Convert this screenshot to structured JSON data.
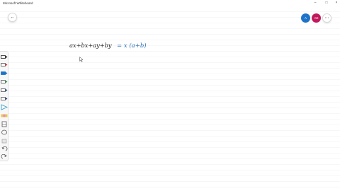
{
  "window": {
    "title": "Microsoft Whiteboard"
  },
  "header": {
    "back_icon": "arrow-left-icon",
    "avatars": [
      {
        "initials": "A",
        "color": "#1e73c8"
      },
      {
        "initials": "AE",
        "color": "#c2185b"
      }
    ],
    "more_icon": "more-icon"
  },
  "toolbar": {
    "tools": [
      {
        "name": "pen-black",
        "color": "#222222"
      },
      {
        "name": "pen-red",
        "color": "#d23a3a"
      },
      {
        "name": "pen-blue",
        "color": "#1e73c8"
      },
      {
        "name": "pen-green",
        "color": "#2e9e4f"
      },
      {
        "name": "pen-darkblue",
        "color": "#2a4f8c"
      },
      {
        "name": "pen-navy",
        "color": "#33407a"
      },
      {
        "name": "pen-cyan",
        "color": "#3aa0c8"
      },
      {
        "name": "highlighter",
        "color": "#e8c84a"
      },
      {
        "name": "eraser",
        "color": "#555555"
      },
      {
        "name": "lasso",
        "color": "#555555"
      },
      {
        "name": "ruler",
        "color": "#777777"
      },
      {
        "name": "undo",
        "color": "#555555"
      },
      {
        "name": "redo",
        "color": "#555555"
      }
    ]
  },
  "ink": {
    "left": "ax+bx+ay+by",
    "right": "= x (a+b)"
  }
}
